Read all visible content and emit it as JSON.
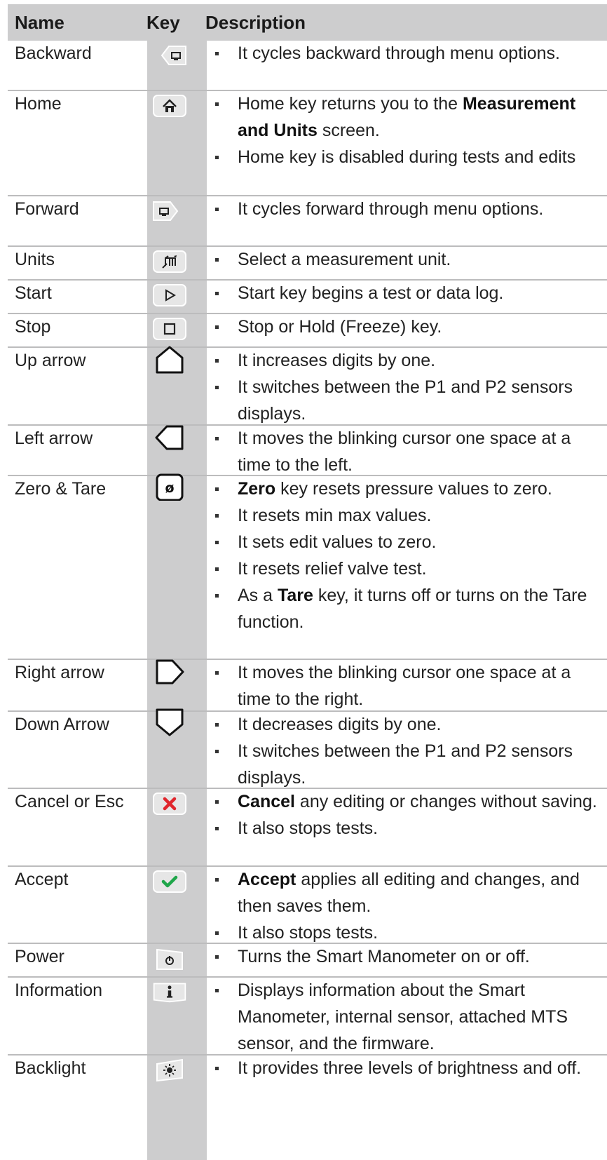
{
  "table": {
    "headers": {
      "name": "Name",
      "key": "Key",
      "description": "Description"
    },
    "rows": [
      {
        "name": "Backward",
        "icon": "backward-icon",
        "bullets": [
          {
            "text": "It cycles backward through menu options."
          }
        ]
      },
      {
        "name": "Home",
        "icon": "home-icon",
        "bullets": [
          {
            "pre": "Home key returns you to the ",
            "bold": "Measurement and Units",
            "post": " screen."
          },
          {
            "text": "Home key is disabled during tests and edits"
          }
        ]
      },
      {
        "name": "Forward",
        "icon": "forward-icon",
        "bullets": [
          {
            "text": "It cycles forward through menu options."
          }
        ]
      },
      {
        "name": "Units",
        "icon": "units-icon",
        "bullets": [
          {
            "text": "Select a measurement unit."
          }
        ]
      },
      {
        "name": "Start",
        "icon": "start-icon",
        "bullets": [
          {
            "text": "Start key begins a test or data log."
          }
        ]
      },
      {
        "name": "Stop",
        "icon": "stop-icon",
        "bullets": [
          {
            "text": "Stop or Hold (Freeze) key."
          }
        ]
      },
      {
        "name": "Up arrow",
        "icon": "up-arrow-icon",
        "bullets": [
          {
            "text": "It increases digits by one."
          },
          {
            "text": "It switches between the P1 and P2 sensors displays."
          }
        ]
      },
      {
        "name": "Left arrow",
        "icon": "left-arrow-icon",
        "bullets": [
          {
            "text": "It moves the blinking cursor one space at a time to the left."
          }
        ]
      },
      {
        "name": "Zero & Tare",
        "icon": "zero-tare-icon",
        "bullets": [
          {
            "pre": "",
            "bold": "Zero",
            "post": " key resets pressure values to zero."
          },
          {
            "text": "It resets min max values."
          },
          {
            "text": "It sets edit values to zero."
          },
          {
            "text": "It resets relief valve test."
          },
          {
            "pre": "As a ",
            "bold": "Tare",
            "post": " key, it turns off or turns on the Tare function."
          }
        ]
      },
      {
        "name": "Right arrow",
        "icon": "right-arrow-icon",
        "bullets": [
          {
            "text": "It moves the blinking cursor one space at a time to the right."
          }
        ]
      },
      {
        "name": "Down Arrow",
        "icon": "down-arrow-icon",
        "bullets": [
          {
            "text": "It decreases digits by one."
          },
          {
            "text": "It switches between the P1 and P2 sensors displays."
          }
        ]
      },
      {
        "name": "Cancel or Esc",
        "icon": "cancel-icon",
        "bullets": [
          {
            "pre": "",
            "bold": "Cancel",
            "post": " any editing or changes without saving."
          },
          {
            "text": "It also stops tests."
          }
        ]
      },
      {
        "name": "Accept",
        "icon": "accept-icon",
        "bullets": [
          {
            "pre": "",
            "bold": "Accept",
            "post": " applies all editing and changes, and then saves them."
          },
          {
            "text": "It also stops tests."
          }
        ]
      },
      {
        "name": "Power",
        "icon": "power-icon",
        "bullets": [
          {
            "text": "Turns the Smart Manometer on or off."
          }
        ]
      },
      {
        "name": "Information",
        "icon": "information-icon",
        "bullets": [
          {
            "text": "Displays information about the Smart Manometer, internal sensor, attached MTS sensor, and the firmware."
          }
        ]
      },
      {
        "name": "Backlight",
        "icon": "backlight-icon",
        "bullets": [
          {
            "text": "It provides three levels of brightness and off."
          }
        ]
      }
    ]
  },
  "colors": {
    "header_bg": "#cdcdce",
    "key_column_bg": "#cdcdce",
    "cancel_red": "#e0262d",
    "accept_green": "#1fa64a"
  }
}
